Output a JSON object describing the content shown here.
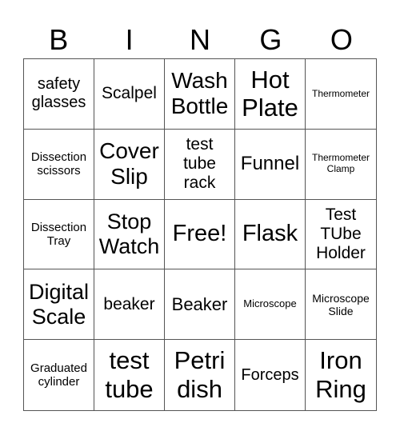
{
  "header": [
    "B",
    "I",
    "N",
    "G",
    "O"
  ],
  "cells": [
    {
      "text": "safety glasses",
      "size": "s20"
    },
    {
      "text": "Scalpel",
      "size": "s21"
    },
    {
      "text": "Wash Bottle",
      "size": "s28"
    },
    {
      "text": "Hot Plate",
      "size": "s31"
    },
    {
      "text": "Thermometer",
      "size": "s12"
    },
    {
      "text": "Dissection scissors",
      "size": "s15"
    },
    {
      "text": "Cover Slip",
      "size": "s28"
    },
    {
      "text": "test tube rack",
      "size": "s21"
    },
    {
      "text": "Funnel",
      "size": "s24"
    },
    {
      "text": "Thermometer Clamp",
      "size": "s12"
    },
    {
      "text": "Dissection Tray",
      "size": "s15"
    },
    {
      "text": "Stop Watch",
      "size": "s27"
    },
    {
      "text": "Free!",
      "size": "s29"
    },
    {
      "text": "Flask",
      "size": "s29"
    },
    {
      "text": "Test TUbe Holder",
      "size": "s21"
    },
    {
      "text": "Digital Scale",
      "size": "s27"
    },
    {
      "text": "beaker",
      "size": "s21"
    },
    {
      "text": "Beaker",
      "size": "s22"
    },
    {
      "text": "Microscope",
      "size": "s13"
    },
    {
      "text": "Microscope Slide",
      "size": "s14"
    },
    {
      "text": "Graduated cylinder",
      "size": "s15"
    },
    {
      "text": "test tube",
      "size": "s31"
    },
    {
      "text": "Petri dish",
      "size": "s31"
    },
    {
      "text": "Forceps",
      "size": "s20"
    },
    {
      "text": "Iron Ring",
      "size": "s31"
    }
  ]
}
